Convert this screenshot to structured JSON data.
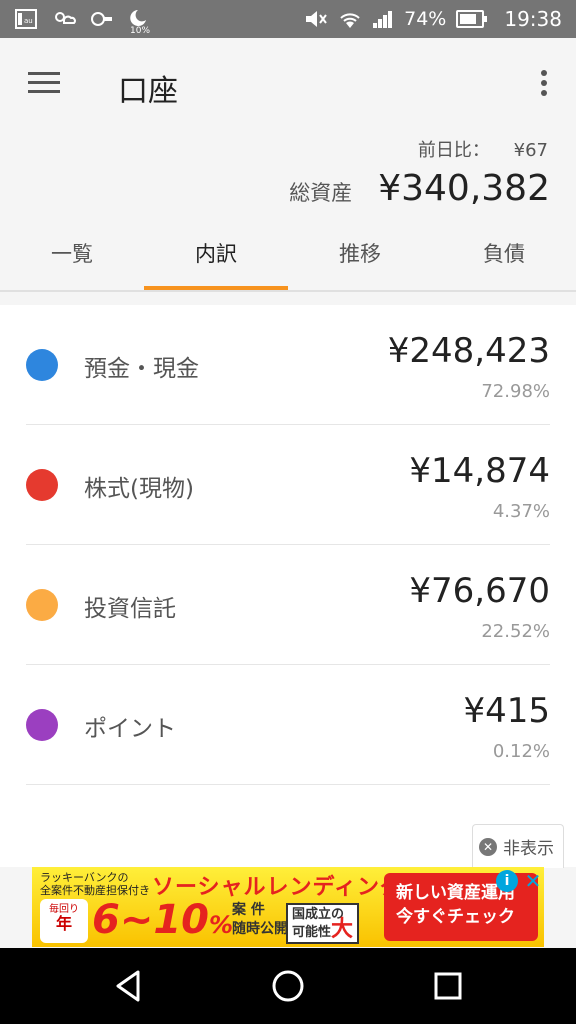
{
  "status_bar": {
    "battery": "74%",
    "time": "19:38",
    "moon_percent": "10%"
  },
  "app_bar": {
    "title": "口座",
    "change_label": "前日比：",
    "change_value": "¥67",
    "total_label": "総資産",
    "total_value": "¥340,382"
  },
  "tabs": [
    {
      "label": "一覧"
    },
    {
      "label": "内訳"
    },
    {
      "label": "推移"
    },
    {
      "label": "負債"
    }
  ],
  "breakdown": [
    {
      "label": "預金・現金",
      "amount": "¥248,423",
      "percent": "72.98%",
      "color": "#2e86de"
    },
    {
      "label": "株式(現物)",
      "amount": "¥14,874",
      "percent": "4.37%",
      "color": "#e53a2f"
    },
    {
      "label": "投資信託",
      "amount": "¥76,670",
      "percent": "22.52%",
      "color": "#fbab44"
    },
    {
      "label": "ポイント",
      "amount": "¥415",
      "percent": "0.12%",
      "color": "#9b3fc0"
    }
  ],
  "hide_ad": {
    "label": "非表示"
  },
  "ad": {
    "small_line1": "ラッキーバンクの",
    "small_line2": "全案件不動産担保付き",
    "headline": "ソーシャルレンディング",
    "year_top": "毎回り",
    "year_mid": "年",
    "big": "6~10",
    "big_unit": "%",
    "mid_line1": "案 件",
    "mid_line2": "随時公開",
    "box_line1": "国成立の",
    "box_line2": "可能性",
    "box_big": "大",
    "cta_line1": "新しい資産運用",
    "cta_line2": "今すぐチェック"
  }
}
